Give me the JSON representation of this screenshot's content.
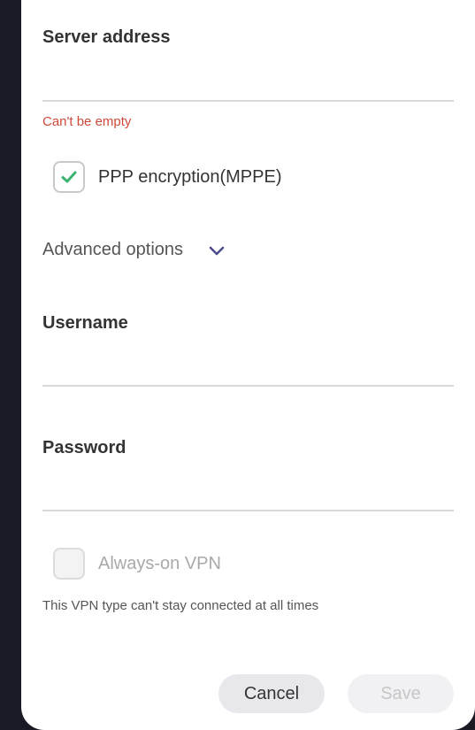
{
  "server": {
    "label": "Server address",
    "value": "",
    "error": "Can't be empty"
  },
  "encryption": {
    "label": "PPP encryption(MPPE)",
    "checked": true
  },
  "advanced": {
    "label": "Advanced options",
    "icon": "chevron-down-icon"
  },
  "username": {
    "label": "Username",
    "value": ""
  },
  "password": {
    "label": "Password",
    "value": ""
  },
  "always_on": {
    "label": "Always-on VPN",
    "checked": false,
    "hint": "This VPN type can't stay connected at all times"
  },
  "buttons": {
    "cancel_label": "Cancel",
    "save_label": "Save"
  },
  "colors": {
    "accent_check": "#3cb371",
    "error": "#d04a3b",
    "chevron": "#4a4a8a"
  }
}
